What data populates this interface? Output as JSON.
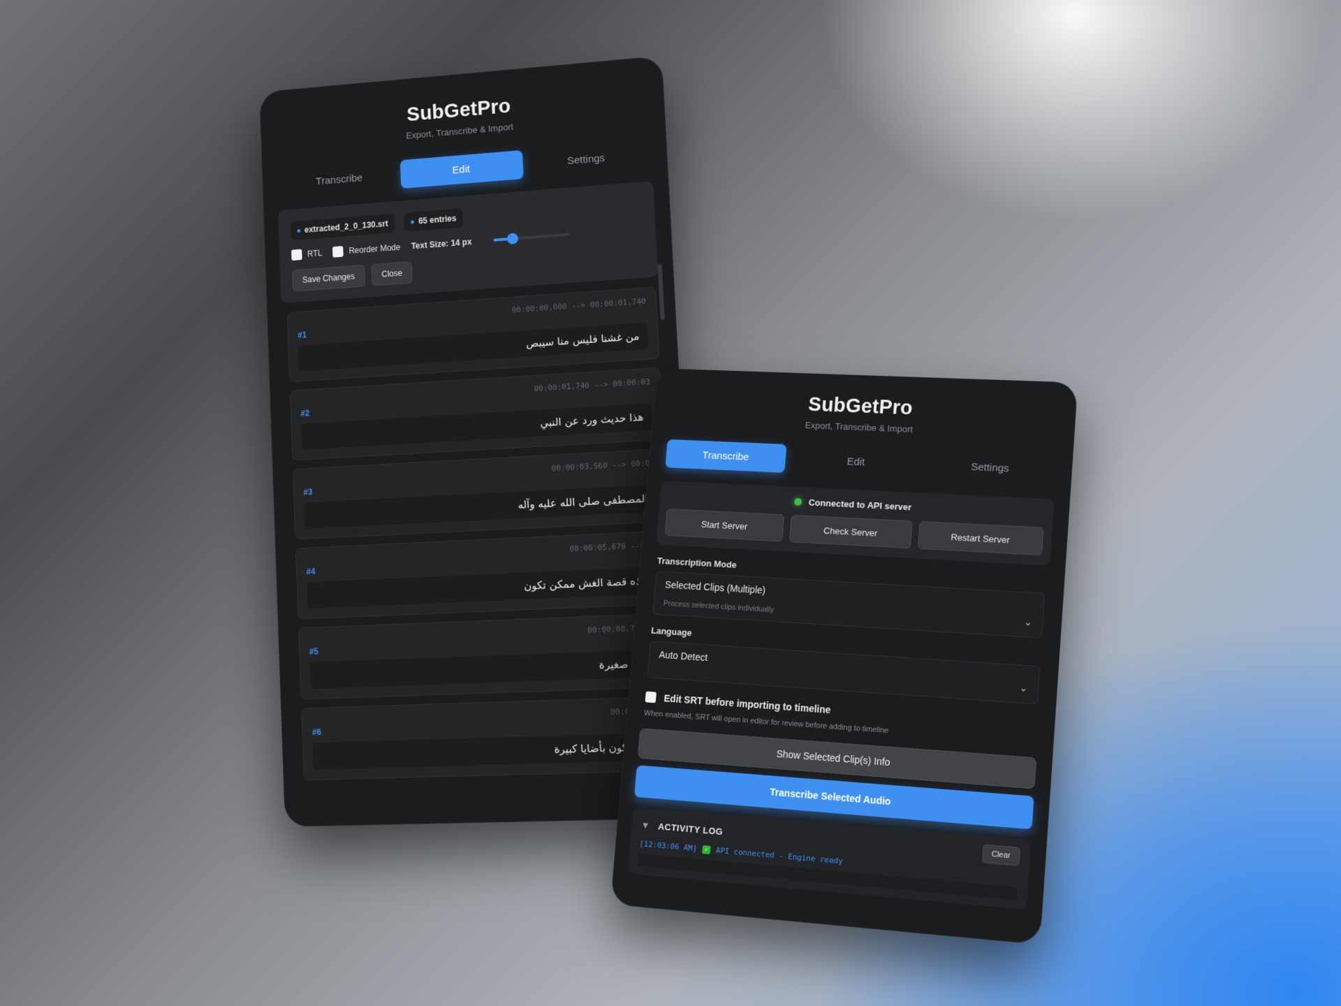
{
  "app": {
    "title": "SubGetPro",
    "subtitle": "Export, Transcribe & Import"
  },
  "tabs": [
    {
      "label": "Transcribe"
    },
    {
      "label": "Edit"
    },
    {
      "label": "Settings"
    }
  ],
  "editor": {
    "file_name": "extracted_2_0_130.srt",
    "entries_count": "65 entries",
    "rtl_label": "RTL",
    "reorder_label": "Reorder Mode",
    "text_size_label": "Text Size:",
    "text_size_value": "14",
    "text_size_unit": "px",
    "text_size_level": 0.25,
    "save_label": "Save Changes",
    "close_label": "Close",
    "entries": [
      {
        "num": "#1",
        "time": "00:00:00,000 --> 00:00:01,740",
        "text": "من غشنا فليس منا سيبص"
      },
      {
        "num": "#2",
        "time": "00:00:01,740 --> 00:00:03",
        "text": "هذا حديث ورد عن النبي"
      },
      {
        "num": "#3",
        "time": "00:00:03,560 --> 00:00",
        "text": "المصطفى صلى الله عليه وآله"
      },
      {
        "num": "#4",
        "time": "00:00:05,679 --> 00",
        "text": "وهذه قصة الغش ممكن تكون"
      },
      {
        "num": "#5",
        "time": "00:00:08,720 -->",
        "text": "بأضايا صغيرة"
      },
      {
        "num": "#6",
        "time": "00:00:09,660",
        "text": "ممكن تكون بأضايا كبيرة"
      }
    ]
  },
  "transcribe": {
    "status_text": "Connected to API server",
    "start_server": "Start Server",
    "check_server": "Check Server",
    "restart_server": "Restart Server",
    "mode_label": "Transcription Mode",
    "mode_value": "Selected Clips (Multiple)",
    "mode_hint": "Process selected clips individually",
    "language_label": "Language",
    "language_value": "Auto Detect",
    "edit_srt_label": "Edit SRT before importing to timeline",
    "edit_srt_hint": "When enabled, SRT will open in editor for review before adding to timeline",
    "show_info_label": "Show Selected Clip(s) Info",
    "transcribe_label": "Transcribe Selected Audio",
    "log_title": "ACTIVITY LOG",
    "clear_label": "Clear",
    "log_time": "[12:03:06 AM]",
    "log_message": "API connected - Engine ready"
  },
  "colors": {
    "accent": "#3f8ff0",
    "status_ok": "#3ac23f",
    "panel_bg": "#1b1c1e"
  }
}
